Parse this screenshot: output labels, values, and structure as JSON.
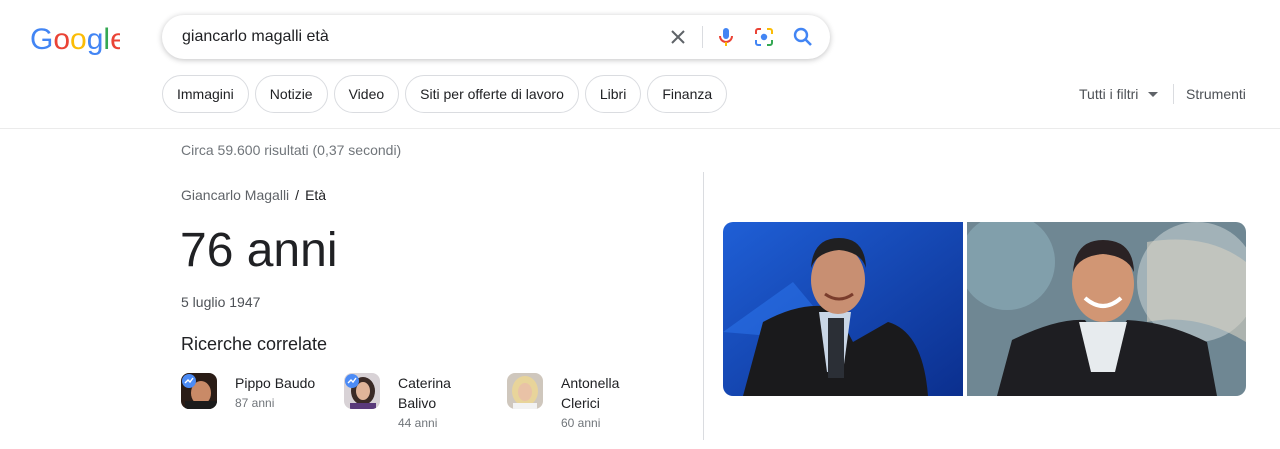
{
  "logo": {
    "letters": [
      "G",
      "o",
      "o",
      "g",
      "l",
      "e"
    ],
    "colors": [
      "#4285F4",
      "#EA4335",
      "#FBBC05",
      "#4285F4",
      "#34A853",
      "#EA4335"
    ]
  },
  "search": {
    "query": "giancarlo magalli età",
    "icons": [
      "clear-icon",
      "mic-icon",
      "lens-icon",
      "search-icon"
    ]
  },
  "chips": [
    "Immagini",
    "Notizie",
    "Video",
    "Siti per offerte di lavoro",
    "Libri",
    "Finanza"
  ],
  "toolbar": {
    "filters": "Tutti i filtri",
    "tools": "Strumenti"
  },
  "results": {
    "stats": "Circa 59.600 risultati (0,37 secondi)"
  },
  "breadcrumb": {
    "parent": "Giancarlo Magalli",
    "separator": "/",
    "current": "Età"
  },
  "answer": {
    "value": "76 anni",
    "birth": "5 luglio 1947"
  },
  "related": {
    "heading": "Ricerche correlate",
    "items": [
      {
        "name": "Pippo Baudo",
        "age": "87 anni"
      },
      {
        "name": "Caterina Balivo",
        "age": "44 anni"
      },
      {
        "name": "Antonella Clerici",
        "age": "60 anni"
      }
    ]
  },
  "colors": {
    "accent": "#1a73e8",
    "text": "#202124",
    "muted": "#70757a",
    "border": "#dadce0"
  }
}
